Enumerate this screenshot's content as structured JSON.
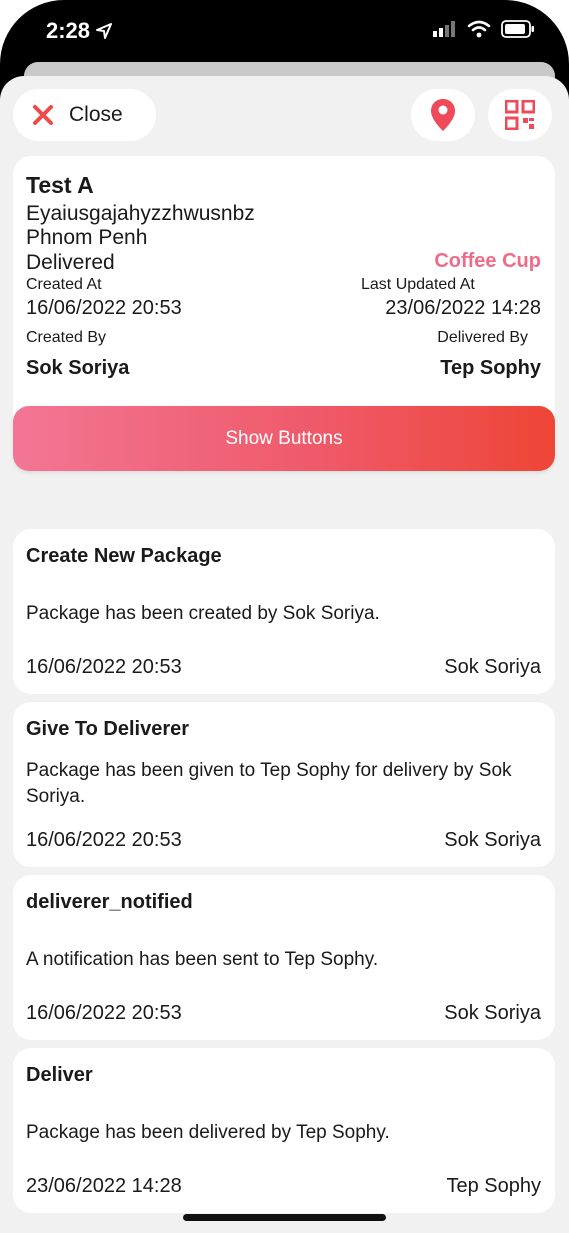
{
  "status_bar": {
    "time": "2:28"
  },
  "toolbar": {
    "close_label": "Close"
  },
  "package": {
    "name": "Test A",
    "code": "Eyaiusgajahyzzhwusnbz",
    "city": "Phnom Penh",
    "status": "Delivered",
    "shop": "Coffee Cup",
    "created_at_label": "Created At",
    "created_at": "16/06/2022 20:53",
    "updated_at_label": "Last Updated At",
    "updated_at": "23/06/2022 14:28",
    "created_by_label": "Created By",
    "created_by": "Sok Soriya",
    "delivered_by_label": "Delivered By",
    "delivered_by": "Tep Sophy"
  },
  "show_buttons_label": "Show Buttons",
  "logs": [
    {
      "title": "Create New Package",
      "description": "Package has been created by Sok Soriya.",
      "date": "16/06/2022 20:53",
      "user": "Sok Soriya"
    },
    {
      "title": "Give To Deliverer",
      "description": "Package has been given to Tep Sophy for delivery by Sok Soriya.",
      "date": "16/06/2022 20:53",
      "user": "Sok Soriya"
    },
    {
      "title": "deliverer_notified",
      "description": "A notification has been sent to Tep Sophy.",
      "date": "16/06/2022 20:53",
      "user": "Sok Soriya"
    },
    {
      "title": "Deliver",
      "description": "Package has been delivered by Tep Sophy.",
      "date": "23/06/2022 14:28",
      "user": "Tep Sophy"
    }
  ],
  "colors": {
    "accent": "#ee4536",
    "pink": "#f06b8a",
    "background": "#f1f1f1"
  }
}
